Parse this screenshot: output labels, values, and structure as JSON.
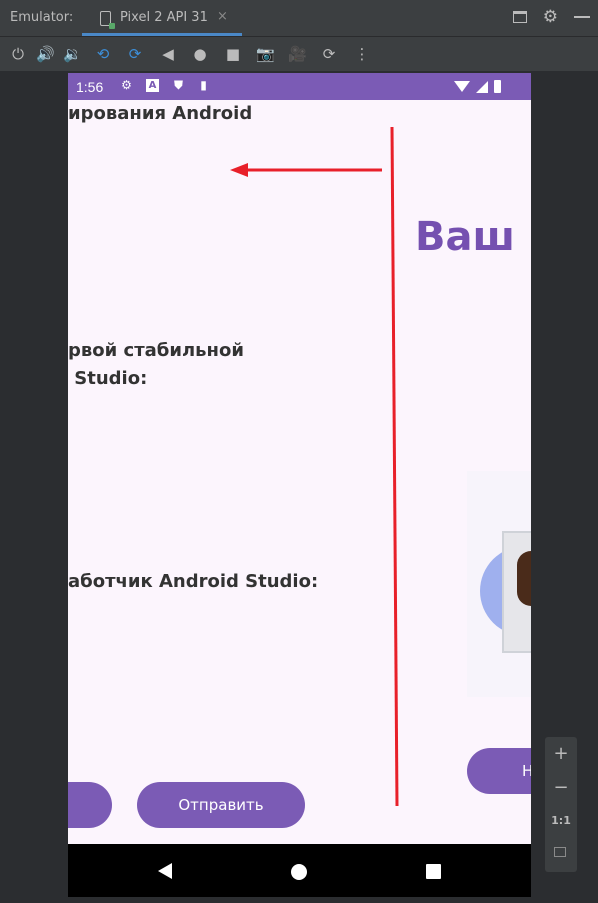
{
  "emulator": {
    "title": "Emulator:",
    "tab_label": "Pixel 2 API 31",
    "tab_close": "×"
  },
  "toolbar": {
    "icons": [
      "power-icon",
      "volume-up-icon",
      "volume-down-icon",
      "rotate-left-icon",
      "rotate-right-icon",
      "back-icon",
      "home-icon",
      "overview-icon",
      "camera-icon",
      "video-icon",
      "snapshot-icon",
      "more-icon"
    ]
  },
  "zoom_panel": {
    "zoom_in": "+",
    "zoom_out": "−",
    "actual_size": "1:1"
  },
  "status_bar": {
    "time": "1:56"
  },
  "screen": {
    "text_line_1": "ирования Android",
    "text_block_2": "рвой стабильной\n Studio:",
    "text_line_3": "аботчик Android Studio:",
    "heading": "Ваш р",
    "button_left": "",
    "button_send": "Отправить",
    "button_right": "Н"
  },
  "colors": {
    "accent": "#7b5bb5",
    "heading": "#7550b0",
    "annotation": "#e8202a",
    "background": "#fcf5fd"
  }
}
